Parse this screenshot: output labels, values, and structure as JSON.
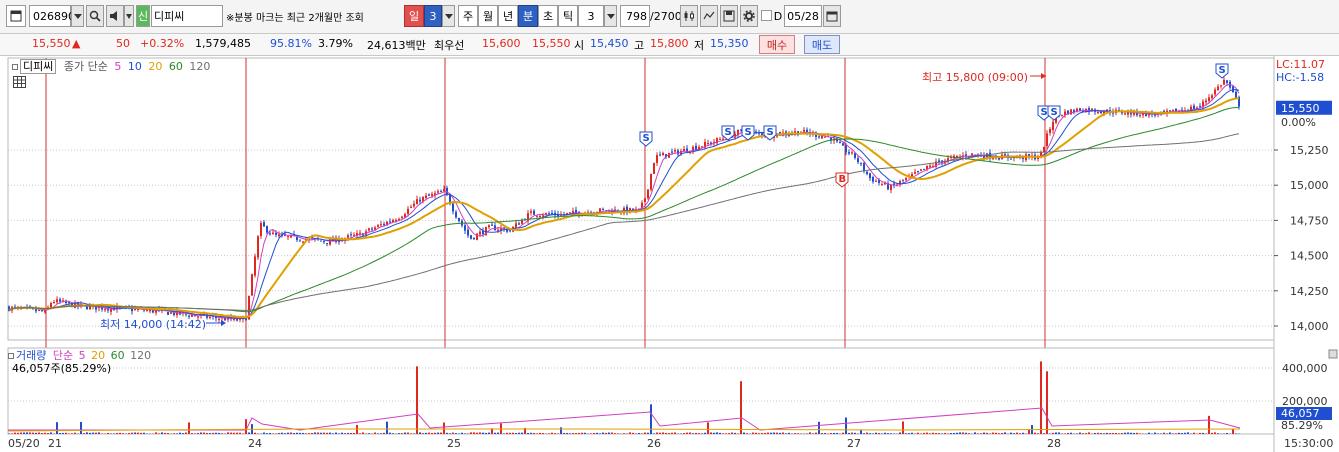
{
  "toolbar": {
    "code": "026890",
    "market_badge": "신",
    "name": "디피씨",
    "notice": "※분봉 마크는 최근 2개월만 조회",
    "period_day": "일",
    "period_day_value": "3",
    "btn_week": "주",
    "btn_month": "월",
    "btn_year": "년",
    "btn_minute": "분",
    "btn_second": "초",
    "btn_tick": "틱",
    "interval_value": "3",
    "count": "798",
    "total": "/2700",
    "checkbox_label": "D",
    "date": "05/28"
  },
  "info": {
    "price": "15,550",
    "change": "50",
    "change_rate": "+0.32%",
    "volume": "1,579,485",
    "vol_ratio": "95.81%",
    "turnover": "3.79%",
    "amount": "24,613백만",
    "best_label": "최우선",
    "ask": "15,600",
    "bid": "15,550",
    "open_label": "시",
    "open": "15,450",
    "high_label": "고",
    "high": "15,800",
    "low_label": "저",
    "low": "15,350",
    "buy_btn": "매수",
    "sell_btn": "매도"
  },
  "price_panel": {
    "legend_name": "디피씨",
    "ma_title": "종가 단순",
    "ma_periods": [
      "5",
      "10",
      "20",
      "60",
      "120"
    ],
    "ma_colors": [
      "#d040c0",
      "#1f4fd0",
      "#e0a000",
      "#2a8a2a",
      "#707070"
    ],
    "high_annotation": "최고 15,800 (09:00)",
    "low_annotation": "최저 14,000 (14:42)",
    "lc_label": "LC:11.07",
    "hc_label": "HC:-1.58",
    "current_price_tag": "15,550",
    "pct_tag": "0.00%",
    "y_ticks": [
      "15,250",
      "15,000",
      "14,750",
      "14,500",
      "14,250",
      "14,000"
    ],
    "markers": [
      {
        "label": "S",
        "type": "sell"
      },
      {
        "label": "S",
        "type": "sell"
      },
      {
        "label": "S",
        "type": "sell"
      },
      {
        "label": "S",
        "type": "sell"
      },
      {
        "label": "B",
        "type": "buy"
      },
      {
        "label": "S",
        "type": "sell"
      },
      {
        "label": "S",
        "type": "sell"
      },
      {
        "label": "S",
        "type": "sell"
      }
    ]
  },
  "volume_panel": {
    "title": "거래량",
    "ma_title": "단순",
    "ma_periods": [
      "5",
      "20",
      "60",
      "120"
    ],
    "value_text": "46,057주(85.29%)",
    "y_ticks": [
      "400,000",
      "200,000"
    ],
    "current_tag": "46,057",
    "pct_tag": "85.29%"
  },
  "x_axis": {
    "labels": [
      "05/20",
      "21",
      "24",
      "25",
      "26",
      "27",
      "28"
    ],
    "right_label": "15:30:00"
  },
  "colors": {
    "up": "#e0281e",
    "down": "#1f4fd0",
    "day_divider": "#d03030",
    "grid": "#c8c8c8"
  }
}
